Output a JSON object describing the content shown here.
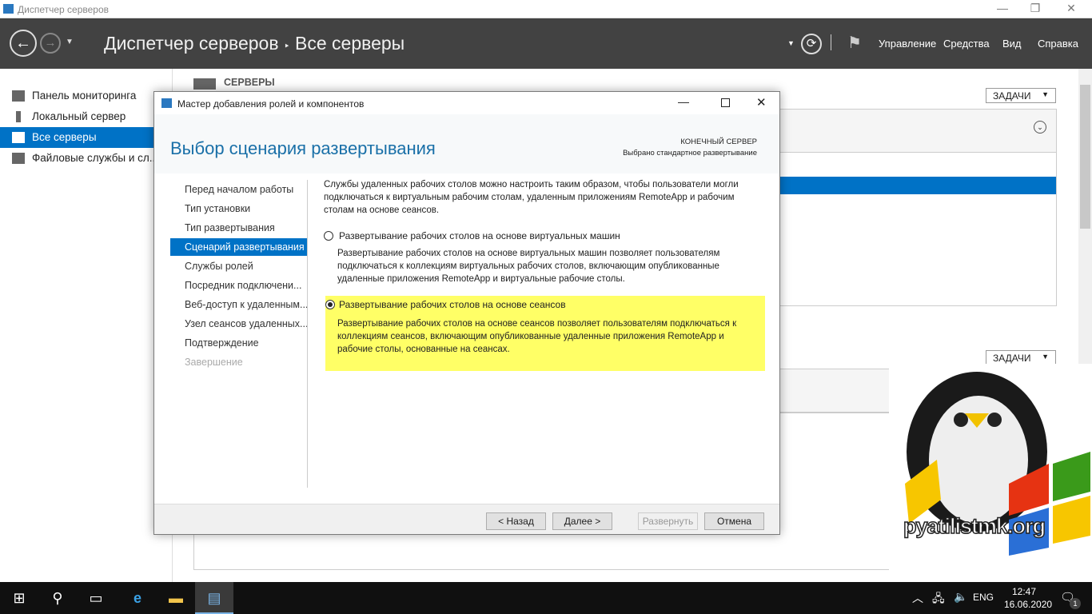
{
  "window": {
    "title": "Диспетчер серверов"
  },
  "header": {
    "breadcrumb_root": "Диспетчер серверов",
    "breadcrumb_sep": "‣",
    "breadcrumb_current": "Все серверы",
    "menu": [
      "Управление",
      "Средства",
      "Вид",
      "Справка"
    ]
  },
  "sidebar": {
    "items": [
      {
        "label": "Панель мониторинга"
      },
      {
        "label": "Локальный сервер"
      },
      {
        "label": "Все серверы"
      },
      {
        "label": "Файловые службы и сл..."
      }
    ]
  },
  "main": {
    "section_title": "СЕРВЕРЫ",
    "tasks_label": "ЗАДАЧИ",
    "tasks_label2": "ЗАДАЧИ"
  },
  "dialog": {
    "title": "Мастер добавления ролей и компонентов",
    "heading": "Выбор сценария развертывания",
    "dest_label": "КОНЕЧНЫЙ СЕРВЕР",
    "dest_value": "Выбрано стандартное развертывание",
    "nav": [
      {
        "label": "Перед началом работы"
      },
      {
        "label": "Тип установки"
      },
      {
        "label": "Тип развертывания"
      },
      {
        "label": "Сценарий развертывания"
      },
      {
        "label": "Службы ролей"
      },
      {
        "label": "Посредник подключени..."
      },
      {
        "label": "Веб-доступ к удаленным..."
      },
      {
        "label": "Узел сеансов удаленных..."
      },
      {
        "label": "Подтверждение"
      },
      {
        "label": "Завершение"
      }
    ],
    "intro": "Службы удаленных рабочих столов можно настроить таким образом, чтобы пользователи могли подключаться к виртуальным рабочим столам, удаленным приложениям RemoteApp и рабочим столам на основе сеансов.",
    "options": [
      {
        "label": "Развертывание рабочих столов на основе виртуальных машин",
        "desc": "Развертывание рабочих столов на основе виртуальных машин позволяет пользователям подключаться к коллекциям виртуальных рабочих столов, включающим опубликованные удаленные приложения RemoteApp и виртуальные рабочие столы.",
        "selected": false
      },
      {
        "label": "Развертывание рабочих столов на основе сеансов",
        "desc": "Развертывание рабочих столов на основе сеансов позволяет пользователям подключаться к коллекциям сеансов, включающим опубликованные удаленные приложения RemoteApp и рабочие столы, основанные на сеансах.",
        "selected": true
      }
    ],
    "buttons": {
      "back": "< Назад",
      "next": "Далее >",
      "deploy": "Развернуть",
      "cancel": "Отмена"
    },
    "highlight_color": "#ffff66"
  },
  "watermark": {
    "text": "pyatilistmk.org"
  },
  "taskbar": {
    "lang": "ENG",
    "time": "12:47",
    "date": "16.06.2020",
    "notifications": "1"
  }
}
